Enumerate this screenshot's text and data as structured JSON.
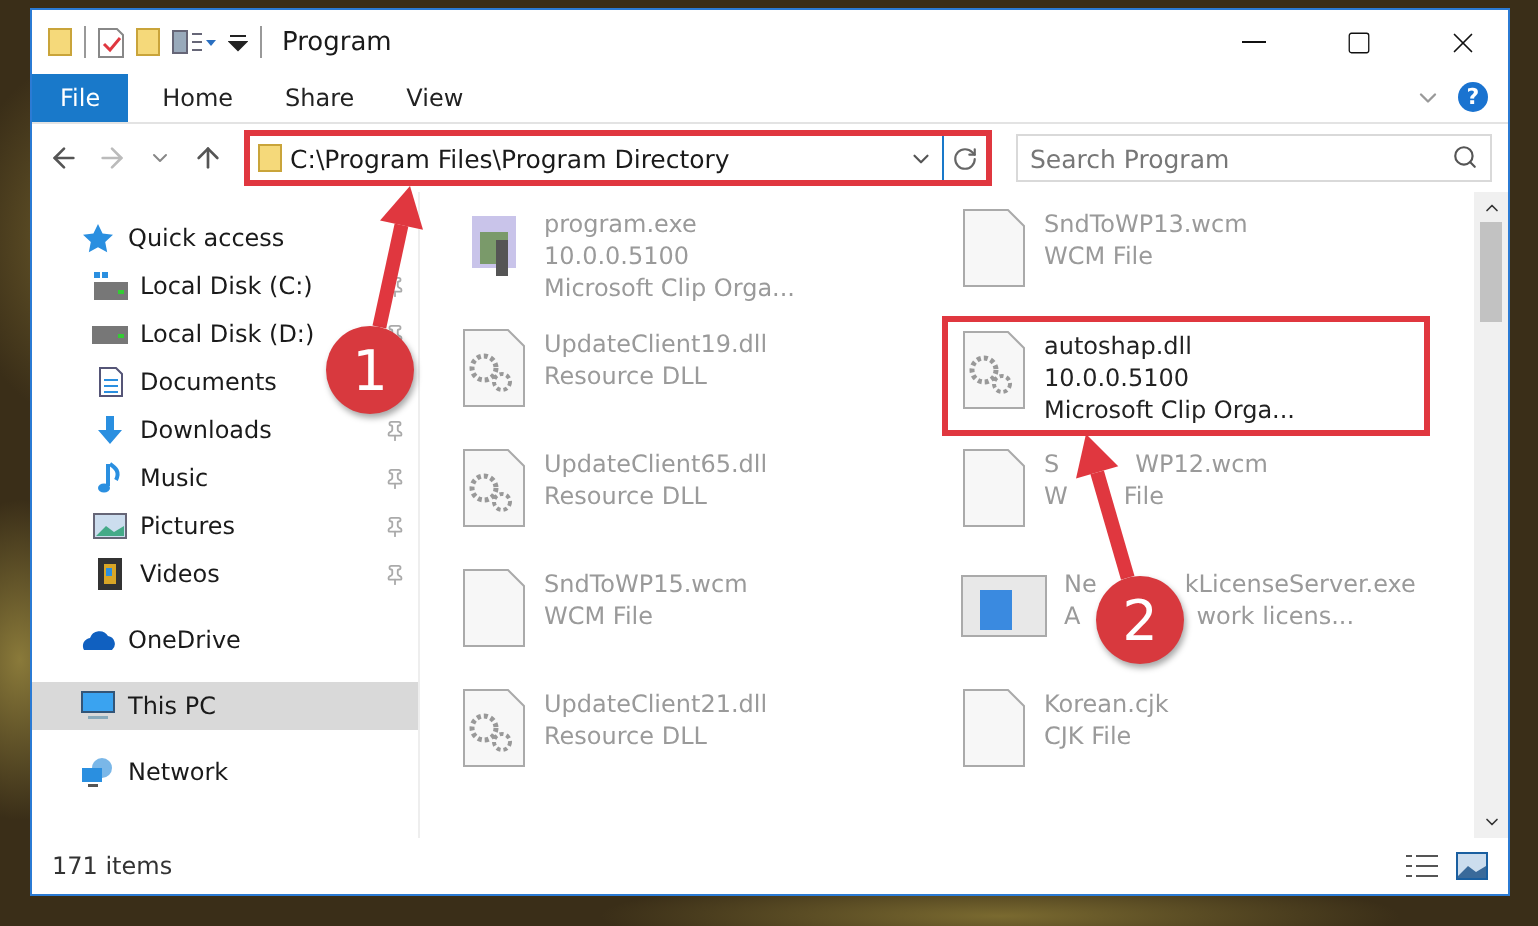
{
  "window": {
    "title": "Program"
  },
  "ribbon_tabs": [
    {
      "label": "File",
      "kind": "file"
    },
    {
      "label": "Home",
      "kind": "tab"
    },
    {
      "label": "Share",
      "kind": "tab"
    },
    {
      "label": "View",
      "kind": "tab"
    }
  ],
  "help_button": "?",
  "address_bar": {
    "path": "C:\\Program Files\\Program Directory",
    "highlighted": true
  },
  "search": {
    "placeholder": "Search Program"
  },
  "sidebar": {
    "items": [
      {
        "label": "Quick access",
        "kind": "star",
        "selected": false,
        "children": [
          {
            "label": "Local Disk (C:)",
            "kind": "system-drive",
            "pinned": true,
            "selected": false
          },
          {
            "label": "Local Disk (D:)",
            "kind": "drive",
            "pinned": true,
            "selected": false
          },
          {
            "label": "Documents",
            "kind": "document",
            "selected": false
          },
          {
            "label": "Downloads",
            "kind": "download",
            "pinned": true,
            "selected": false
          },
          {
            "label": "Music",
            "kind": "music",
            "pinned": true,
            "selected": false
          },
          {
            "label": "Pictures",
            "kind": "pictures",
            "pinned": true,
            "selected": false
          },
          {
            "label": "Videos",
            "kind": "videos",
            "pinned": true,
            "selected": false
          }
        ]
      },
      {
        "label": "OneDrive",
        "kind": "cloud",
        "selected": false
      },
      {
        "label": "This PC",
        "kind": "pc",
        "selected": true
      },
      {
        "label": "Network",
        "kind": "network",
        "selected": false
      }
    ]
  },
  "files": [
    {
      "name": [
        "program.exe"
      ],
      "details": [
        [
          "10.0.0.5100"
        ],
        [
          "Microsoft Clip Orga..."
        ]
      ],
      "kind": "exe",
      "highlighted": false
    },
    {
      "name": [
        "SndToWP13.wcm"
      ],
      "details": [
        [
          "WCM File"
        ]
      ],
      "kind": "blank",
      "highlighted": false
    },
    {
      "name": [
        "UpdateClient19.dll"
      ],
      "details": [
        [
          "Resource DLL"
        ]
      ],
      "kind": "dll",
      "highlighted": false
    },
    {
      "name": [
        "autoshap.dll"
      ],
      "details": [
        [
          "10.0.0.5100"
        ],
        [
          "Microsoft Clip Orga..."
        ]
      ],
      "kind": "dll",
      "highlighted": true
    },
    {
      "name": [
        "UpdateClient65.dll"
      ],
      "details": [
        [
          "Resource DLL"
        ]
      ],
      "kind": "dll",
      "highlighted": false
    },
    {
      "name": [
        "S",
        "WP12.wcm"
      ],
      "details": [
        [
          "W",
          "File"
        ]
      ],
      "kind": "blank",
      "highlighted": false
    },
    {
      "name": [
        "SndToWP15.wcm"
      ],
      "details": [
        [
          "WCM File"
        ]
      ],
      "kind": "blank",
      "highlighted": false
    },
    {
      "name": [
        "Ne",
        "kLicenseServer.exe"
      ],
      "details": [
        [
          "A",
          "work licens..."
        ]
      ],
      "kind": "app",
      "highlighted": false
    },
    {
      "name": [
        "UpdateClient21.dll"
      ],
      "details": [
        [
          "Resource DLL"
        ]
      ],
      "kind": "dll",
      "highlighted": false
    },
    {
      "name": [
        "Korean.cjk"
      ],
      "details": [
        [
          "CJK File"
        ]
      ],
      "kind": "blank",
      "highlighted": false
    }
  ],
  "status_bar": {
    "item_count": "171 items"
  },
  "annotations": [
    {
      "number": "1"
    },
    {
      "number": "2"
    }
  ]
}
